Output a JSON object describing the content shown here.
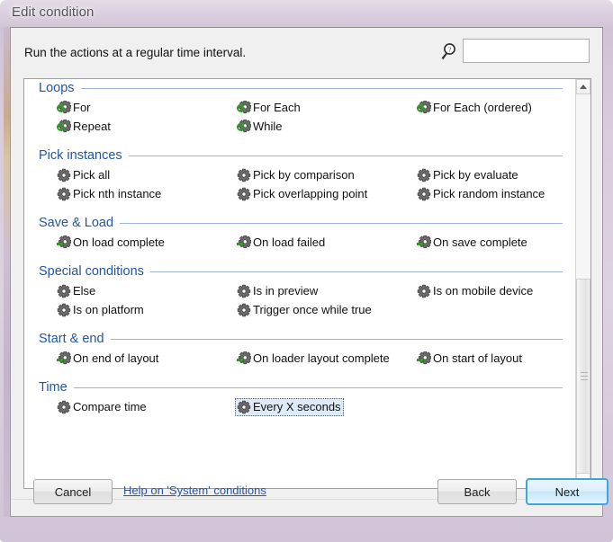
{
  "window": {
    "title": "Edit condition"
  },
  "header": {
    "description": "Run the actions at a regular time interval.",
    "search": {
      "icon": "search-help-magnifier-icon",
      "value": "",
      "placeholder": ""
    }
  },
  "list": {
    "groups": [
      {
        "title": "Loops",
        "icon": "gear-loop-icon",
        "items": [
          {
            "label": "For",
            "icon": "gear-loop-icon",
            "selected": false
          },
          {
            "label": "For Each",
            "icon": "gear-loop-icon",
            "selected": false
          },
          {
            "label": "For Each (ordered)",
            "icon": "gear-loop-icon",
            "selected": false
          },
          {
            "label": "Repeat",
            "icon": "gear-loop-icon",
            "selected": false
          },
          {
            "label": "While",
            "icon": "gear-loop-icon",
            "selected": false
          }
        ]
      },
      {
        "title": "Pick instances",
        "icon": "gear-icon",
        "items": [
          {
            "label": "Pick all",
            "icon": "gear-icon",
            "selected": false
          },
          {
            "label": "Pick by comparison",
            "icon": "gear-icon",
            "selected": false
          },
          {
            "label": "Pick by evaluate",
            "icon": "gear-icon",
            "selected": false
          },
          {
            "label": "Pick nth instance",
            "icon": "gear-icon",
            "selected": false
          },
          {
            "label": "Pick overlapping point",
            "icon": "gear-icon",
            "selected": false
          },
          {
            "label": "Pick random instance",
            "icon": "gear-icon",
            "selected": false
          }
        ]
      },
      {
        "title": "Save & Load",
        "icon": "gear-arrow-icon",
        "items": [
          {
            "label": "On load complete",
            "icon": "gear-arrow-icon",
            "selected": false
          },
          {
            "label": "On load failed",
            "icon": "gear-arrow-icon",
            "selected": false
          },
          {
            "label": "On save complete",
            "icon": "gear-arrow-icon",
            "selected": false
          }
        ]
      },
      {
        "title": "Special conditions",
        "icon": "gear-icon",
        "items": [
          {
            "label": "Else",
            "icon": "gear-icon",
            "selected": false
          },
          {
            "label": "Is in preview",
            "icon": "gear-icon",
            "selected": false
          },
          {
            "label": "Is on mobile device",
            "icon": "gear-icon",
            "selected": false
          },
          {
            "label": "Is on platform",
            "icon": "gear-icon",
            "selected": false
          },
          {
            "label": "Trigger once while true",
            "icon": "gear-icon",
            "selected": false
          }
        ]
      },
      {
        "title": "Start & end",
        "icon": "gear-arrow-icon",
        "items": [
          {
            "label": "On end of layout",
            "icon": "gear-arrow-icon",
            "selected": false
          },
          {
            "label": "On loader layout complete",
            "icon": "gear-arrow-icon",
            "selected": false
          },
          {
            "label": "On start of layout",
            "icon": "gear-arrow-icon",
            "selected": false
          }
        ]
      },
      {
        "title": "Time",
        "icon": "gear-icon",
        "items": [
          {
            "label": "Compare time",
            "icon": "gear-icon",
            "selected": false
          },
          {
            "label": "Every X seconds",
            "icon": "gear-icon",
            "selected": true
          }
        ]
      }
    ]
  },
  "scrollbar": {
    "up_arrow": "chevron-up-icon",
    "down_arrow": "chevron-down-icon"
  },
  "footer": {
    "cancel_label": "Cancel",
    "help_link": "Help on 'System' conditions",
    "back_label": "Back",
    "next_label": "Next"
  },
  "colors": {
    "group_title": "#23569c",
    "group_rule": "#9bb4d6",
    "link": "#2255a8",
    "selection_bg": "#dcebf7",
    "next_accent": "#3aa7dd",
    "titlebar": "#d6c8db"
  }
}
